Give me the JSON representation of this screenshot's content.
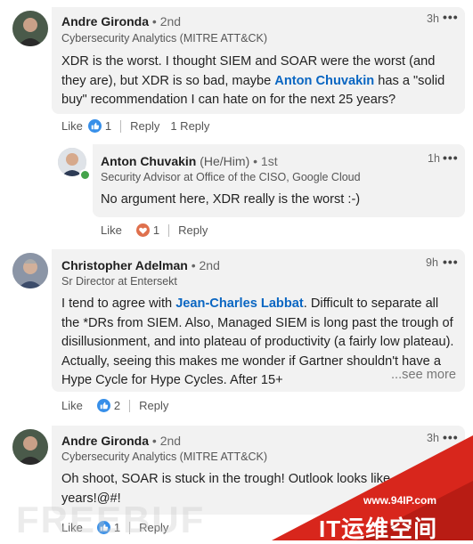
{
  "comments": [
    {
      "name": "Andre Gironda",
      "degree": "• 2nd",
      "headline": "Cybersecurity Analytics (MITRE ATT&CK)",
      "time": "3h",
      "body_pre": "XDR is the worst. I thought SIEM and SOAR were the worst (and they are), but XDR is so bad, maybe ",
      "mention": "Anton Chuvakin",
      "body_post": " has a \"solid buy\" recommendation I can hate on for the next 25 years?",
      "like": "Like",
      "react_count": "1",
      "reply": "Reply",
      "replies": "1 Reply"
    },
    {
      "name": "Anton Chuvakin",
      "pronouns": "(He/Him)",
      "degree": "• 1st",
      "headline": "Security Advisor at Office of the CISO, Google Cloud",
      "time": "1h",
      "body": "No argument here, XDR really is the worst :-)",
      "like": "Like",
      "react_count": "1",
      "reply": "Reply"
    },
    {
      "name": "Christopher Adelman",
      "degree": "• 2nd",
      "headline": "Sr Director at Entersekt",
      "time": "9h",
      "body_pre": "I tend to agree with ",
      "mention": "Jean-Charles Labbat",
      "body_post": ". Difficult to separate all the *DRs from SIEM. Also, Managed SIEM is long past the trough of disillusionment, and into plateau of productivity (a fairly low plateau). Actually, seeing this makes me wonder if Gartner shouldn't have a Hype Cycle for Hype Cycles. After 15+",
      "see_more": "...see more",
      "like": "Like",
      "react_count": "2",
      "reply": "Reply"
    },
    {
      "name": "Andre Gironda",
      "degree": "• 2nd",
      "headline": "Cybersecurity Analytics (MITRE ATT&CK)",
      "time": "3h",
      "body_line1": "Oh shoot, SOAR is stuck in the trough! Outlook looks like",
      "body_line2": "years!@#!",
      "like": "Like",
      "react_count": "1",
      "reply": "Reply"
    }
  ],
  "more_icon": "ellipsis-icon",
  "watermark": {
    "url": "www.94IP.com",
    "brand": "IT运维空间",
    "freebuf": "FREEBUF"
  },
  "colors": {
    "accent": "#0a66c2",
    "bubble": "#f2f2f2",
    "watermark_red": "#d8261c"
  }
}
